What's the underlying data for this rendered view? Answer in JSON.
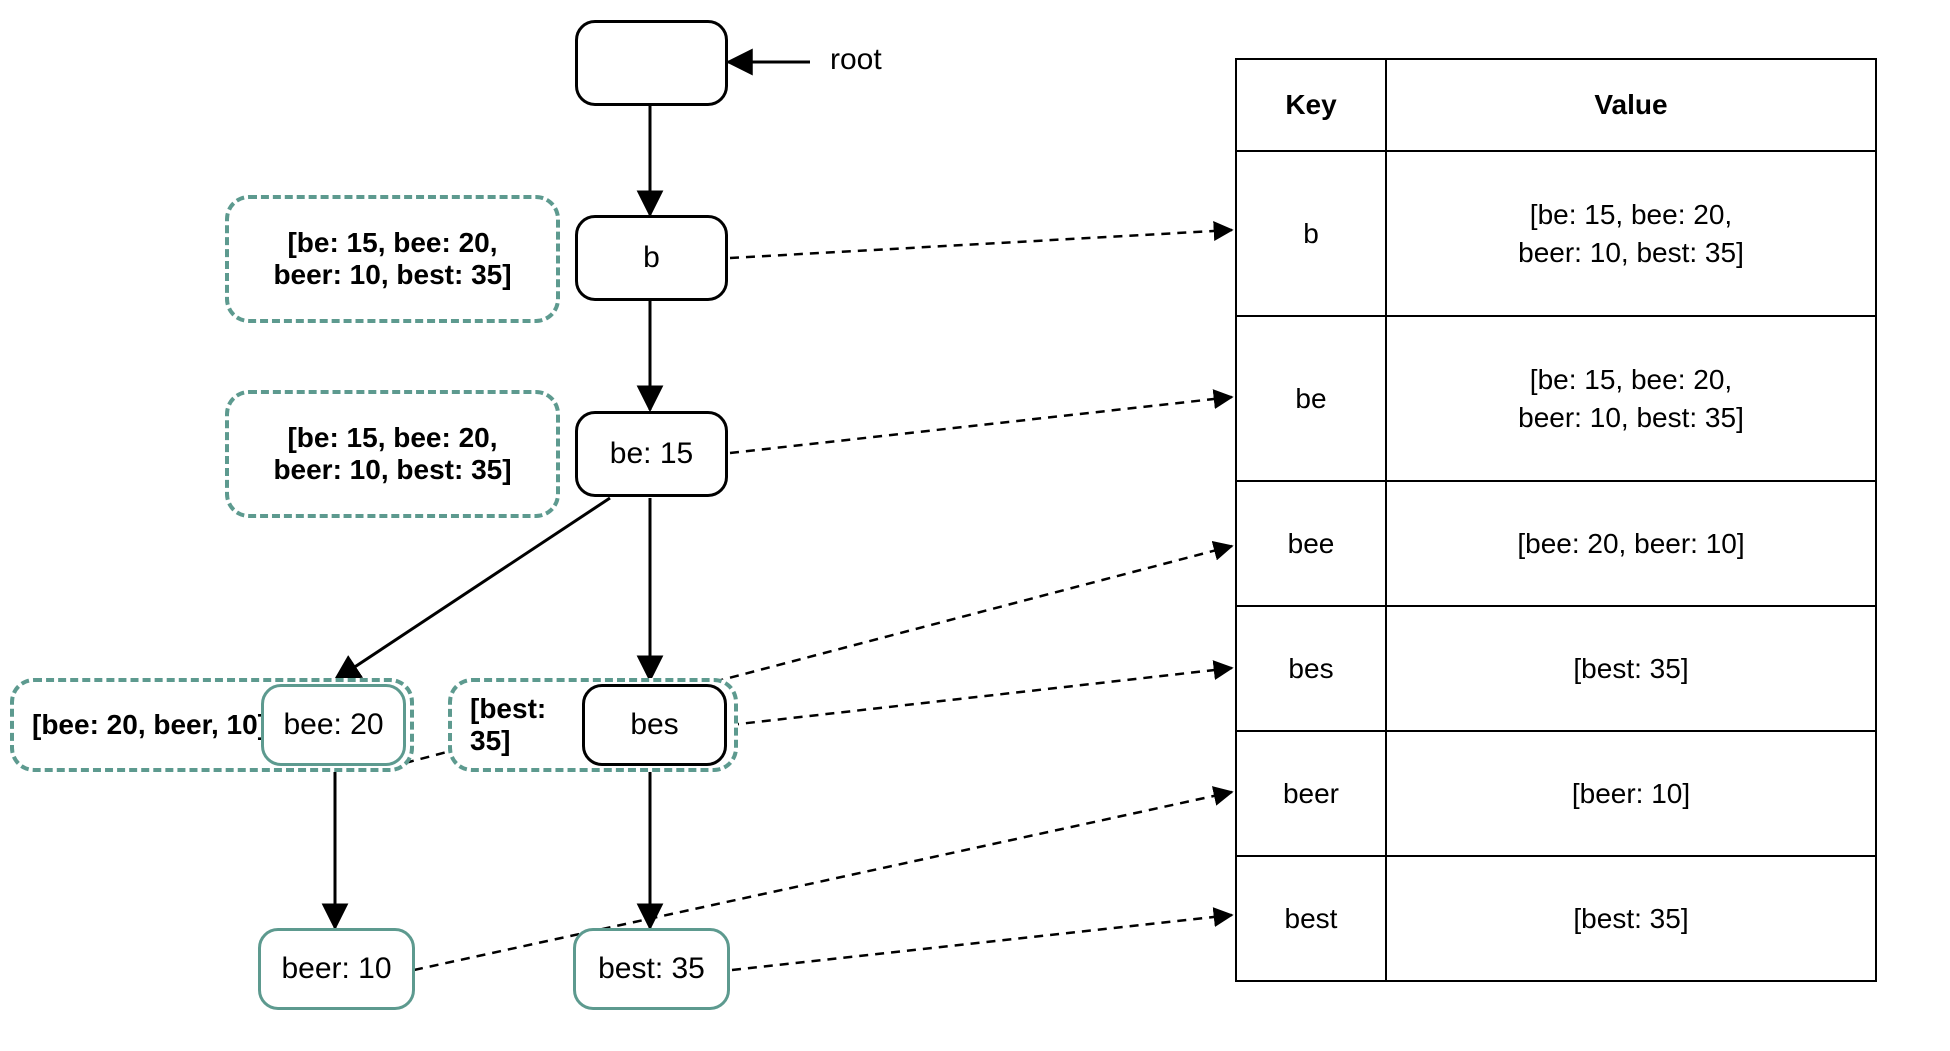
{
  "rootLabel": "root",
  "nodes": {
    "root": {
      "label": ""
    },
    "b": {
      "label": "b"
    },
    "be": {
      "label": "be: 15"
    },
    "bee": {
      "label": "bee: 20"
    },
    "bes": {
      "label": "bes"
    },
    "beer": {
      "label": "beer: 10"
    },
    "best": {
      "label": "best: 35"
    }
  },
  "annotations": {
    "b": "[be: 15, bee: 20,\nbeer: 10, best: 35]",
    "be": "[be: 15, bee: 20,\nbeer: 10, best: 35]",
    "bee": "[bee: 20, beer, 10]",
    "bes": "[best: 35]"
  },
  "table": {
    "headers": {
      "key": "Key",
      "value": "Value"
    },
    "rows": [
      {
        "key": "b",
        "value": "[be: 15, bee: 20,\nbeer: 10, best: 35]"
      },
      {
        "key": "be",
        "value": "[be: 15, bee: 20,\nbeer: 10, best: 35]"
      },
      {
        "key": "bee",
        "value": "[bee: 20, beer: 10]"
      },
      {
        "key": "bes",
        "value": "[best: 35]"
      },
      {
        "key": "beer",
        "value": "[beer: 10]"
      },
      {
        "key": "best",
        "value": "[best: 35]"
      }
    ]
  }
}
